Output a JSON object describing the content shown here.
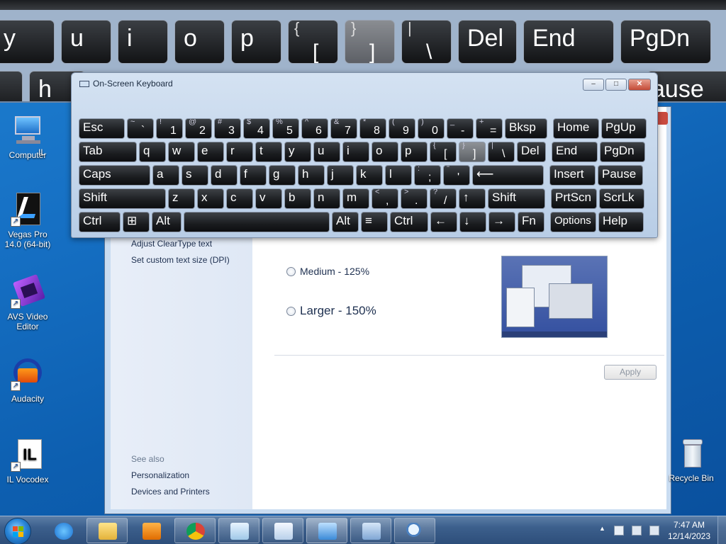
{
  "magnifier": {
    "top_row": [
      "y",
      "u",
      "i",
      "o",
      "p",
      "[",
      "]",
      "\\",
      "Del",
      "End",
      "PgDn"
    ],
    "top_row_sup": {
      "5": "{",
      "6": "}",
      "7": "|"
    },
    "bottom_row": [
      "h",
      "ause"
    ]
  },
  "desktop": {
    "icons": [
      {
        "label": "Computer"
      },
      {
        "label": "IL"
      },
      {
        "label": "Vegas Pro 14.0 (64-bit)"
      },
      {
        "label": "AVS Video Editor"
      },
      {
        "label": "Audacity"
      },
      {
        "label": "IL Vocodex"
      },
      {
        "label": "Recycle Bin"
      }
    ]
  },
  "control_panel": {
    "side_links": [
      "Adjust ClearType text",
      "Set custom text size (DPI)"
    ],
    "see_also_heading": "See also",
    "see_also_links": [
      "Personalization",
      "Devices and Printers"
    ],
    "options": [
      {
        "label": "Medium - 125%",
        "selected": false
      },
      {
        "label": "Larger - 150%",
        "selected": false
      }
    ],
    "apply_label": "Apply"
  },
  "osk": {
    "title": "On-Screen Keyboard",
    "window_buttons": {
      "minimize": "–",
      "restore": "□",
      "close": "✕"
    },
    "rows": [
      [
        {
          "main": "Esc"
        },
        {
          "sup": "~",
          "sub": "`"
        },
        {
          "sup": "!",
          "sub": "1"
        },
        {
          "sup": "@",
          "sub": "2"
        },
        {
          "sup": "#",
          "sub": "3"
        },
        {
          "sup": "$",
          "sub": "4"
        },
        {
          "sup": "%",
          "sub": "5"
        },
        {
          "sup": "^",
          "sub": "6"
        },
        {
          "sup": "&",
          "sub": "7"
        },
        {
          "sup": "*",
          "sub": "8"
        },
        {
          "sup": "(",
          "sub": "9"
        },
        {
          "sup": ")",
          "sub": "0"
        },
        {
          "sup": "_",
          "sub": "-"
        },
        {
          "sup": "+",
          "sub": "="
        },
        {
          "main": "Bksp"
        },
        {
          "main": "Home"
        },
        {
          "main": "PgUp"
        }
      ],
      [
        {
          "main": "Tab"
        },
        {
          "main": "q"
        },
        {
          "main": "w"
        },
        {
          "main": "e"
        },
        {
          "main": "r"
        },
        {
          "main": "t"
        },
        {
          "main": "y"
        },
        {
          "main": "u"
        },
        {
          "main": "i"
        },
        {
          "main": "o"
        },
        {
          "main": "p"
        },
        {
          "sup": "{",
          "sub": "["
        },
        {
          "sup": "}",
          "sub": "]",
          "highlight": true
        },
        {
          "sup": "|",
          "sub": "\\"
        },
        {
          "main": "Del"
        },
        {
          "main": "End"
        },
        {
          "main": "PgDn"
        }
      ],
      [
        {
          "main": "Caps"
        },
        {
          "main": "a"
        },
        {
          "main": "s"
        },
        {
          "main": "d"
        },
        {
          "main": "f"
        },
        {
          "main": "g"
        },
        {
          "main": "h"
        },
        {
          "main": "j"
        },
        {
          "main": "k"
        },
        {
          "main": "l"
        },
        {
          "sup": ":",
          "sub": ";"
        },
        {
          "sup": "\"",
          "sub": "'"
        },
        {
          "main": "⟵"
        },
        {
          "main": "Insert"
        },
        {
          "main": "Pause"
        }
      ],
      [
        {
          "main": "Shift"
        },
        {
          "main": "z"
        },
        {
          "main": "x"
        },
        {
          "main": "c"
        },
        {
          "main": "v"
        },
        {
          "main": "b"
        },
        {
          "main": "n"
        },
        {
          "main": "m"
        },
        {
          "sup": "<",
          "sub": ","
        },
        {
          "sup": ">",
          "sub": "."
        },
        {
          "sup": "?",
          "sub": "/"
        },
        {
          "main": "↑"
        },
        {
          "main": "Shift"
        },
        {
          "main": "PrtScn"
        },
        {
          "main": "ScrLk"
        }
      ],
      [
        {
          "main": "Ctrl"
        },
        {
          "main": "⊞"
        },
        {
          "main": "Alt"
        },
        {
          "main": ""
        },
        {
          "main": "Alt"
        },
        {
          "main": "≡"
        },
        {
          "main": "Ctrl"
        },
        {
          "main": "←"
        },
        {
          "main": "↓"
        },
        {
          "main": "→"
        },
        {
          "main": "Fn"
        },
        {
          "main": "Options"
        },
        {
          "main": "Help"
        }
      ]
    ]
  },
  "taskbar": {
    "clock_time": "7:47 AM",
    "clock_date": "12/14/2023",
    "tray_arrow": "▲"
  }
}
